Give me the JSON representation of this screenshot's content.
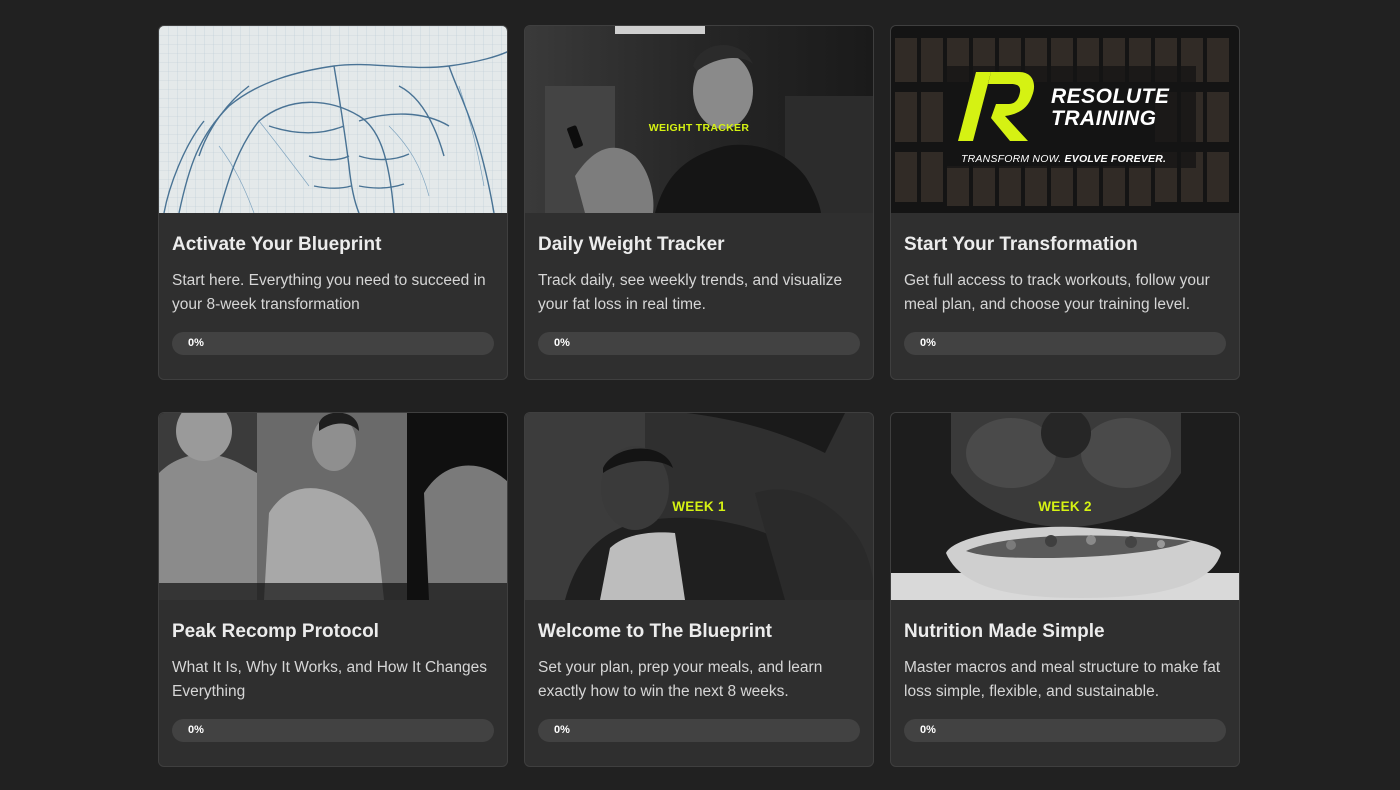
{
  "courses": [
    {
      "title": "Activate Your Blueprint",
      "description": "Start here. Everything you need to succeed in your 8-week transformation",
      "progress_label": "0%",
      "progress": 0
    },
    {
      "title": "Daily Weight Tracker",
      "description": "Track daily, see weekly trends, and visualize your fat loss in real time.",
      "progress_label": "0%",
      "progress": 0,
      "overlay": "WEIGHT TRACKER"
    },
    {
      "title": "Start Your Transformation",
      "description": "Get full access to track workouts, follow your meal plan, and choose your training level.",
      "progress_label": "0%",
      "progress": 0,
      "brand_line1": "RESOLUTE",
      "brand_line2": "TRAINING",
      "tagline_a": "TRANSFORM NOW.",
      "tagline_b": "EVOLVE FOREVER."
    },
    {
      "title": "Peak Recomp Protocol",
      "description": "What It Is, Why It Works, and How It Changes Everything",
      "progress_label": "0%",
      "progress": 0
    },
    {
      "title": "Welcome to The Blueprint",
      "description": "Set your plan, prep your meals, and learn exactly how to win the next 8 weeks.",
      "progress_label": "0%",
      "progress": 0,
      "overlay": "WEEK 1"
    },
    {
      "title": "Nutrition Made Simple",
      "description": "Master macros and meal structure to make fat loss simple, flexible, and sustainable.",
      "progress_label": "0%",
      "progress": 0,
      "overlay": "WEEK 2"
    }
  ],
  "colors": {
    "accent": "#d5f213",
    "page_bg": "#212121",
    "card_bg": "#2f2f2f",
    "progress_track": "#424242"
  }
}
